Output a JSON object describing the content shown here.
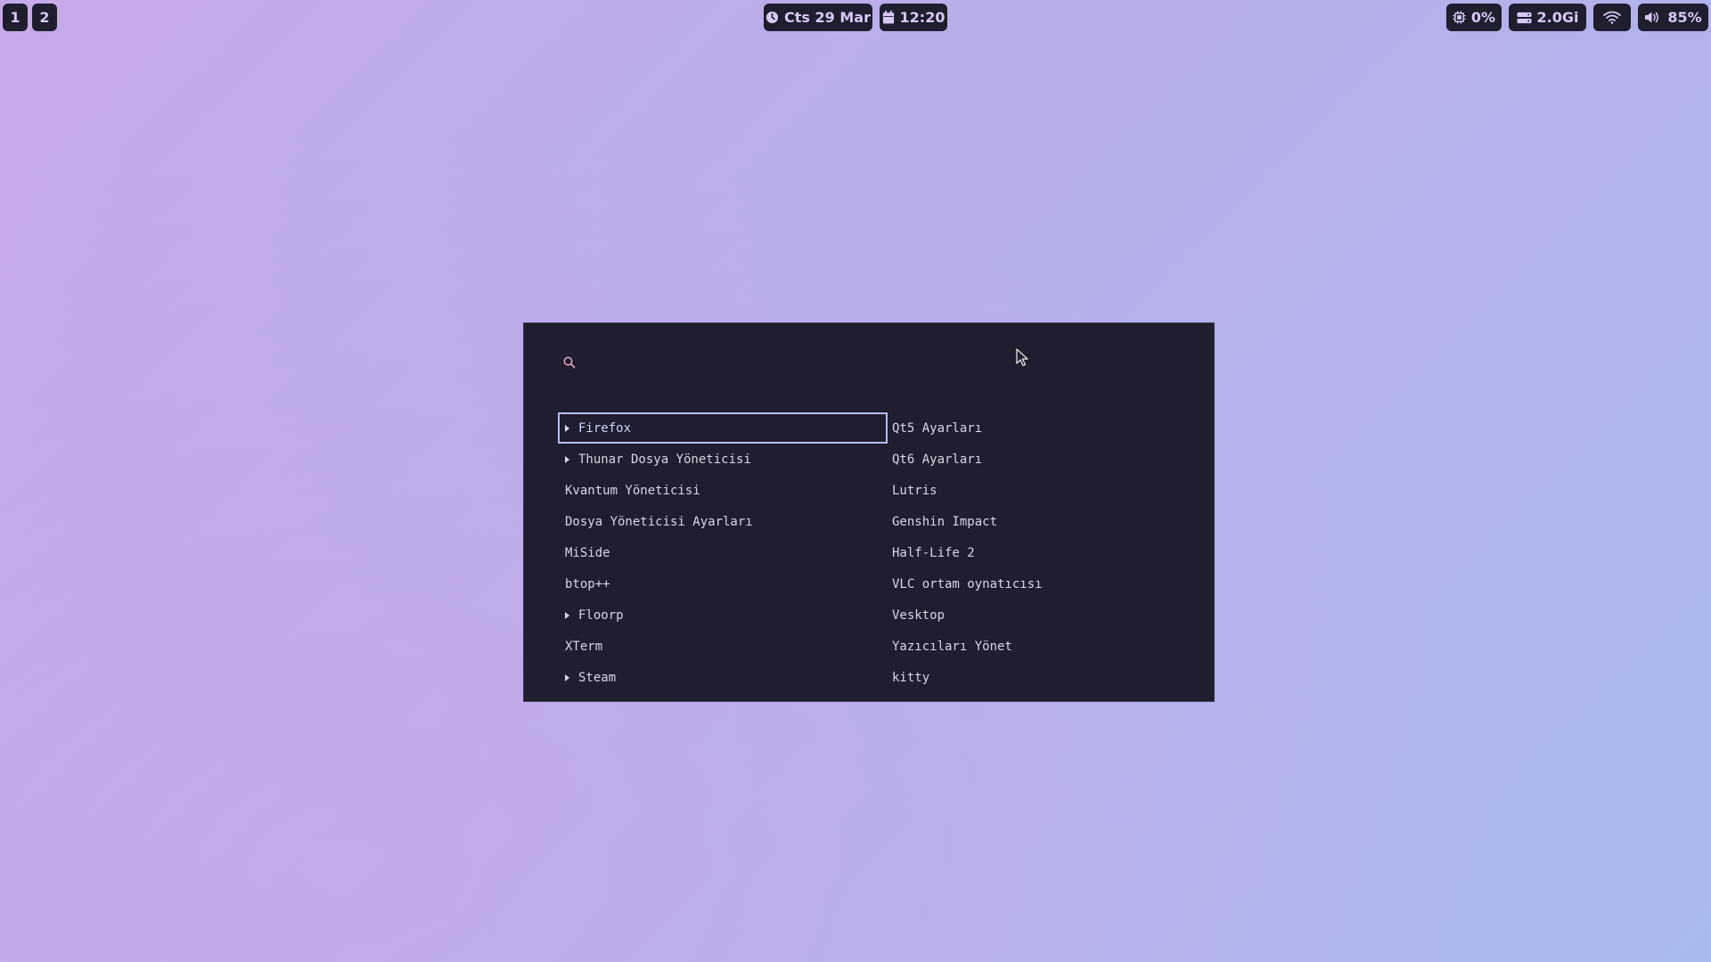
{
  "topbar": {
    "workspaces": [
      "1",
      "2"
    ],
    "date": "Cts 29 Mar",
    "time": "12:20",
    "cpu": "0%",
    "memory": "2.0Gi",
    "volume": "85%",
    "icons": {
      "date": "clock-icon",
      "time": "calendar-icon",
      "cpu": "cpu-chip-icon",
      "memory": "memory-icon",
      "network": "wifi-icon",
      "volume": "speaker-icon"
    }
  },
  "launcher": {
    "search": {
      "value": "",
      "placeholder": "",
      "icon": "search-icon"
    },
    "left_items": [
      {
        "label": "Firefox",
        "expandable": true,
        "selected": true
      },
      {
        "label": "Thunar Dosya Yöneticisi",
        "expandable": true
      },
      {
        "label": "Kvantum Yöneticisi"
      },
      {
        "label": "Dosya Yöneticisi Ayarları"
      },
      {
        "label": "MiSide"
      },
      {
        "label": "btop++"
      },
      {
        "label": "Floorp",
        "expandable": true
      },
      {
        "label": "XTerm"
      },
      {
        "label": "Steam",
        "expandable": true
      }
    ],
    "right_items": [
      {
        "label": "Qt5 Ayarları"
      },
      {
        "label": "Qt6 Ayarları"
      },
      {
        "label": "Lutris"
      },
      {
        "label": "Genshin Impact"
      },
      {
        "label": "Half-Life 2"
      },
      {
        "label": "VLC ortam oynatıcısı"
      },
      {
        "label": "Vesktop"
      },
      {
        "label": "Yazıcıları Yönet"
      },
      {
        "label": "kitty"
      }
    ]
  },
  "colors": {
    "bar_bg": "#1e1e2e",
    "bar_text": "#d8c8f5",
    "launcher_bg": "#1e1e2e",
    "selection_border": "#b4befe",
    "search_icon": "#f5a3c7"
  }
}
